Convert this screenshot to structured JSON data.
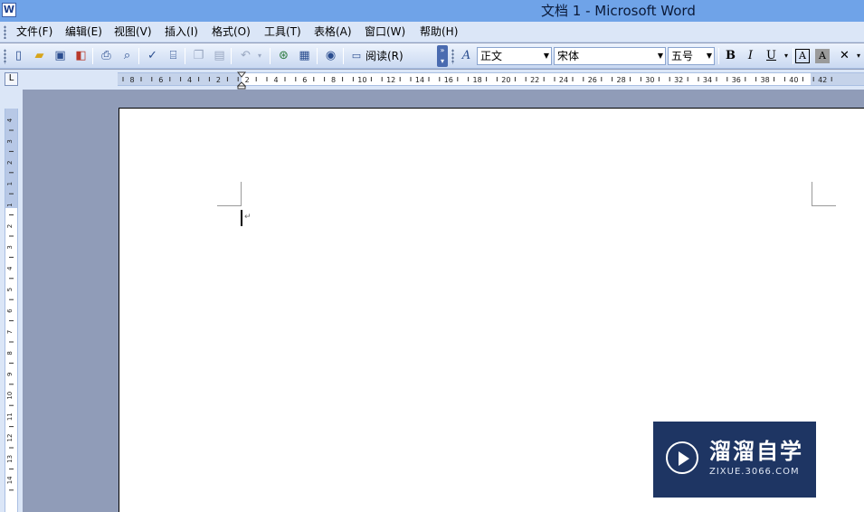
{
  "window": {
    "title": "文档 1 - Microsoft Word",
    "icon": "word-doc-icon"
  },
  "menu": [
    {
      "label": "文件(F)"
    },
    {
      "label": "编辑(E)"
    },
    {
      "label": "视图(V)"
    },
    {
      "label": "插入(I)"
    },
    {
      "label": "格式(O)"
    },
    {
      "label": "工具(T)"
    },
    {
      "label": "表格(A)"
    },
    {
      "label": "窗口(W)"
    },
    {
      "label": "帮助(H)"
    }
  ],
  "toolbar": {
    "icons": [
      "new-doc-icon",
      "open-folder-icon",
      "save-icon",
      "permission-icon",
      "print-icon",
      "print-preview-icon",
      "spelling-icon",
      "research-icon",
      "copy-icon",
      "paste-icon",
      "undo-icon",
      "hyperlink-icon",
      "table-icon",
      "help-icon"
    ],
    "read_label": "阅读(R)",
    "style_value": "正文",
    "font_value": "宋体",
    "size_value": "五号",
    "bold_label": "B",
    "italic_label": "I",
    "underline_label": "U",
    "char_border_label": "A",
    "char_shading_label": "A"
  },
  "ruler": {
    "h_labels": [
      "8",
      "6",
      "4",
      "2",
      "2",
      "4",
      "6",
      "8",
      "10",
      "12",
      "14",
      "16",
      "18",
      "20",
      "22",
      "24",
      "26",
      "28",
      "30",
      "32",
      "34",
      "36",
      "38",
      "40",
      "42"
    ],
    "v_labels": [
      "4",
      "3",
      "2",
      "1",
      "1",
      "2",
      "3",
      "4",
      "5",
      "6",
      "7",
      "8",
      "9",
      "10",
      "11",
      "12",
      "13",
      "14"
    ]
  },
  "watermark": {
    "title": "溜溜自学",
    "subtitle": "ZIXUE.3066.COM"
  },
  "colors": {
    "titlebar": "#6fa3e8",
    "menubar": "#dbe6f7",
    "workspace": "#909cb8",
    "watermark": "#1e3563"
  }
}
